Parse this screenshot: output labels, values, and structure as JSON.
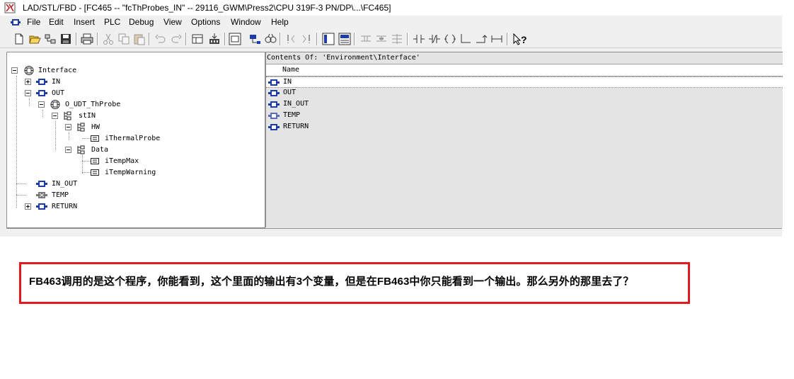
{
  "window": {
    "title": "LAD/STL/FBD  - [FC465 -- \"fcThProbes_IN\" -- 29116_GWM\\Press2\\CPU 319F-3 PN/DP\\...\\FC465]"
  },
  "menu": {
    "items": [
      "File",
      "Edit",
      "Insert",
      "PLC",
      "Debug",
      "View",
      "Options",
      "Window",
      "Help"
    ]
  },
  "toolbar": {
    "icons": [
      "new-icon",
      "open-icon",
      "online-icon",
      "save-icon",
      "print-icon",
      "cut-icon",
      "copy-icon",
      "paste-icon",
      "download-icon",
      "undo-icon",
      "redo-icon",
      "overview-icon",
      "network-icon",
      "monitor-icon",
      "prev-error-icon",
      "next-error-icon",
      "program-elements-icon",
      "details-icon",
      "network-insert-icon",
      "branch-icon",
      "close-branch-icon",
      "no-contact-icon",
      "nc-contact-icon",
      "coil-icon",
      "open-branch-icon",
      "close-icon",
      "connection-icon",
      "help-icon"
    ]
  },
  "tree": {
    "root": "Interface",
    "in": "IN",
    "out": "OUT",
    "udt": "O_UDT_ThProbe",
    "stin": "stIN",
    "hw": "HW",
    "thermal": "iThermalProbe",
    "data": "Data",
    "tempmax": "iTempMax",
    "tempwarn": "iTempWarning",
    "inout": "IN_OUT",
    "temp": "TEMP",
    "return": "RETURN"
  },
  "contents": {
    "header": "Contents Of: 'Environment\\Interface'",
    "column": "Name",
    "rows": [
      "IN",
      "OUT",
      "IN_OUT",
      "TEMP",
      "RETURN"
    ]
  },
  "note": {
    "text": "FB463调用的是这个程序，你能看到，这个里面的输出有3个变量，但是在FB463中你只能看到一个输出。那么另外的那里去了？"
  },
  "colors": {
    "note_border": "#e21a1f",
    "param_icon_blue": "#1e3ca8"
  }
}
